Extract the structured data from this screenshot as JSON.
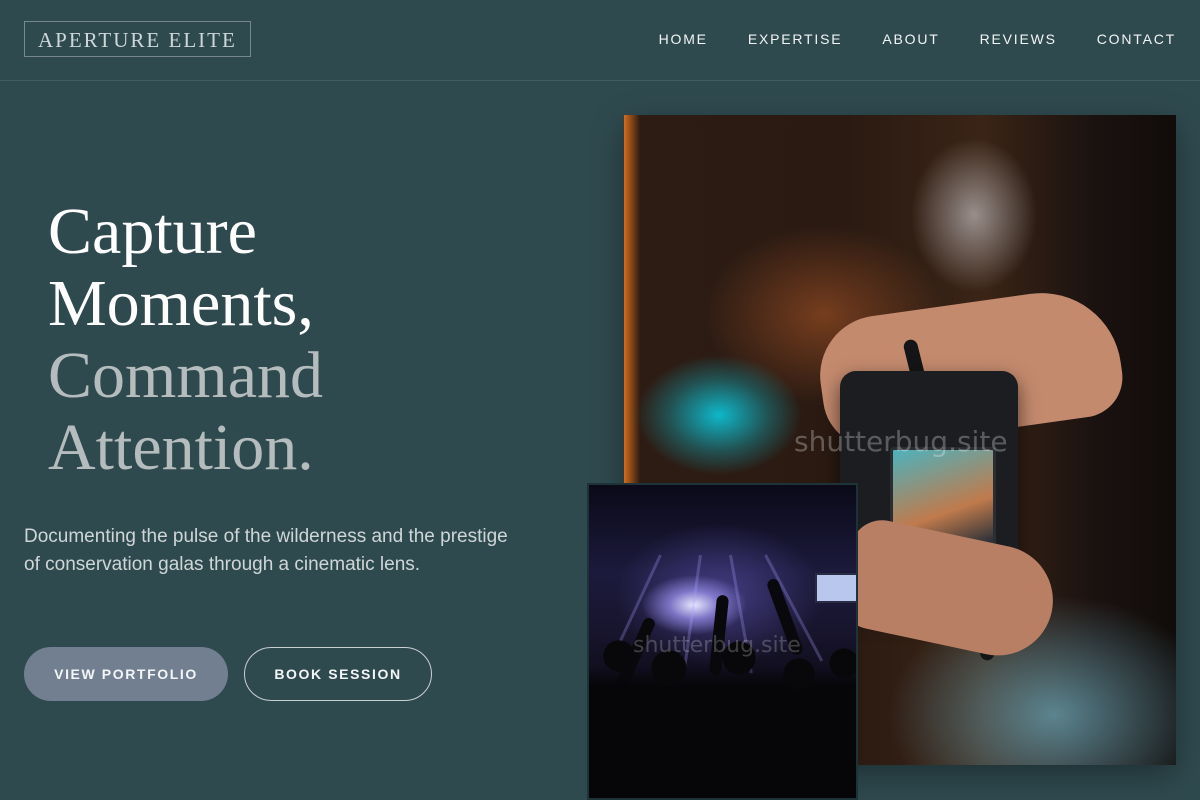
{
  "header": {
    "logo": "APERTURE ELITE",
    "nav": [
      "HOME",
      "EXPERTISE",
      "ABOUT",
      "REVIEWS",
      "CONTACT"
    ]
  },
  "hero": {
    "headline_line1": "Capture",
    "headline_line2": "Moments,",
    "headline_line3": "Command",
    "headline_line4": "Attention.",
    "subtitle": "Documenting the pulse of the wilderness and the prestige of conservation galas through a cinematic lens.",
    "primary_button": "VIEW PORTFOLIO",
    "secondary_button": "BOOK SESSION"
  },
  "images": {
    "watermark": "shutterbug.site"
  },
  "colors": {
    "background": "#2f4a4f",
    "primary_button": "#727f91",
    "headline_muted": "#b5bcbd",
    "text": "#ffffff"
  }
}
